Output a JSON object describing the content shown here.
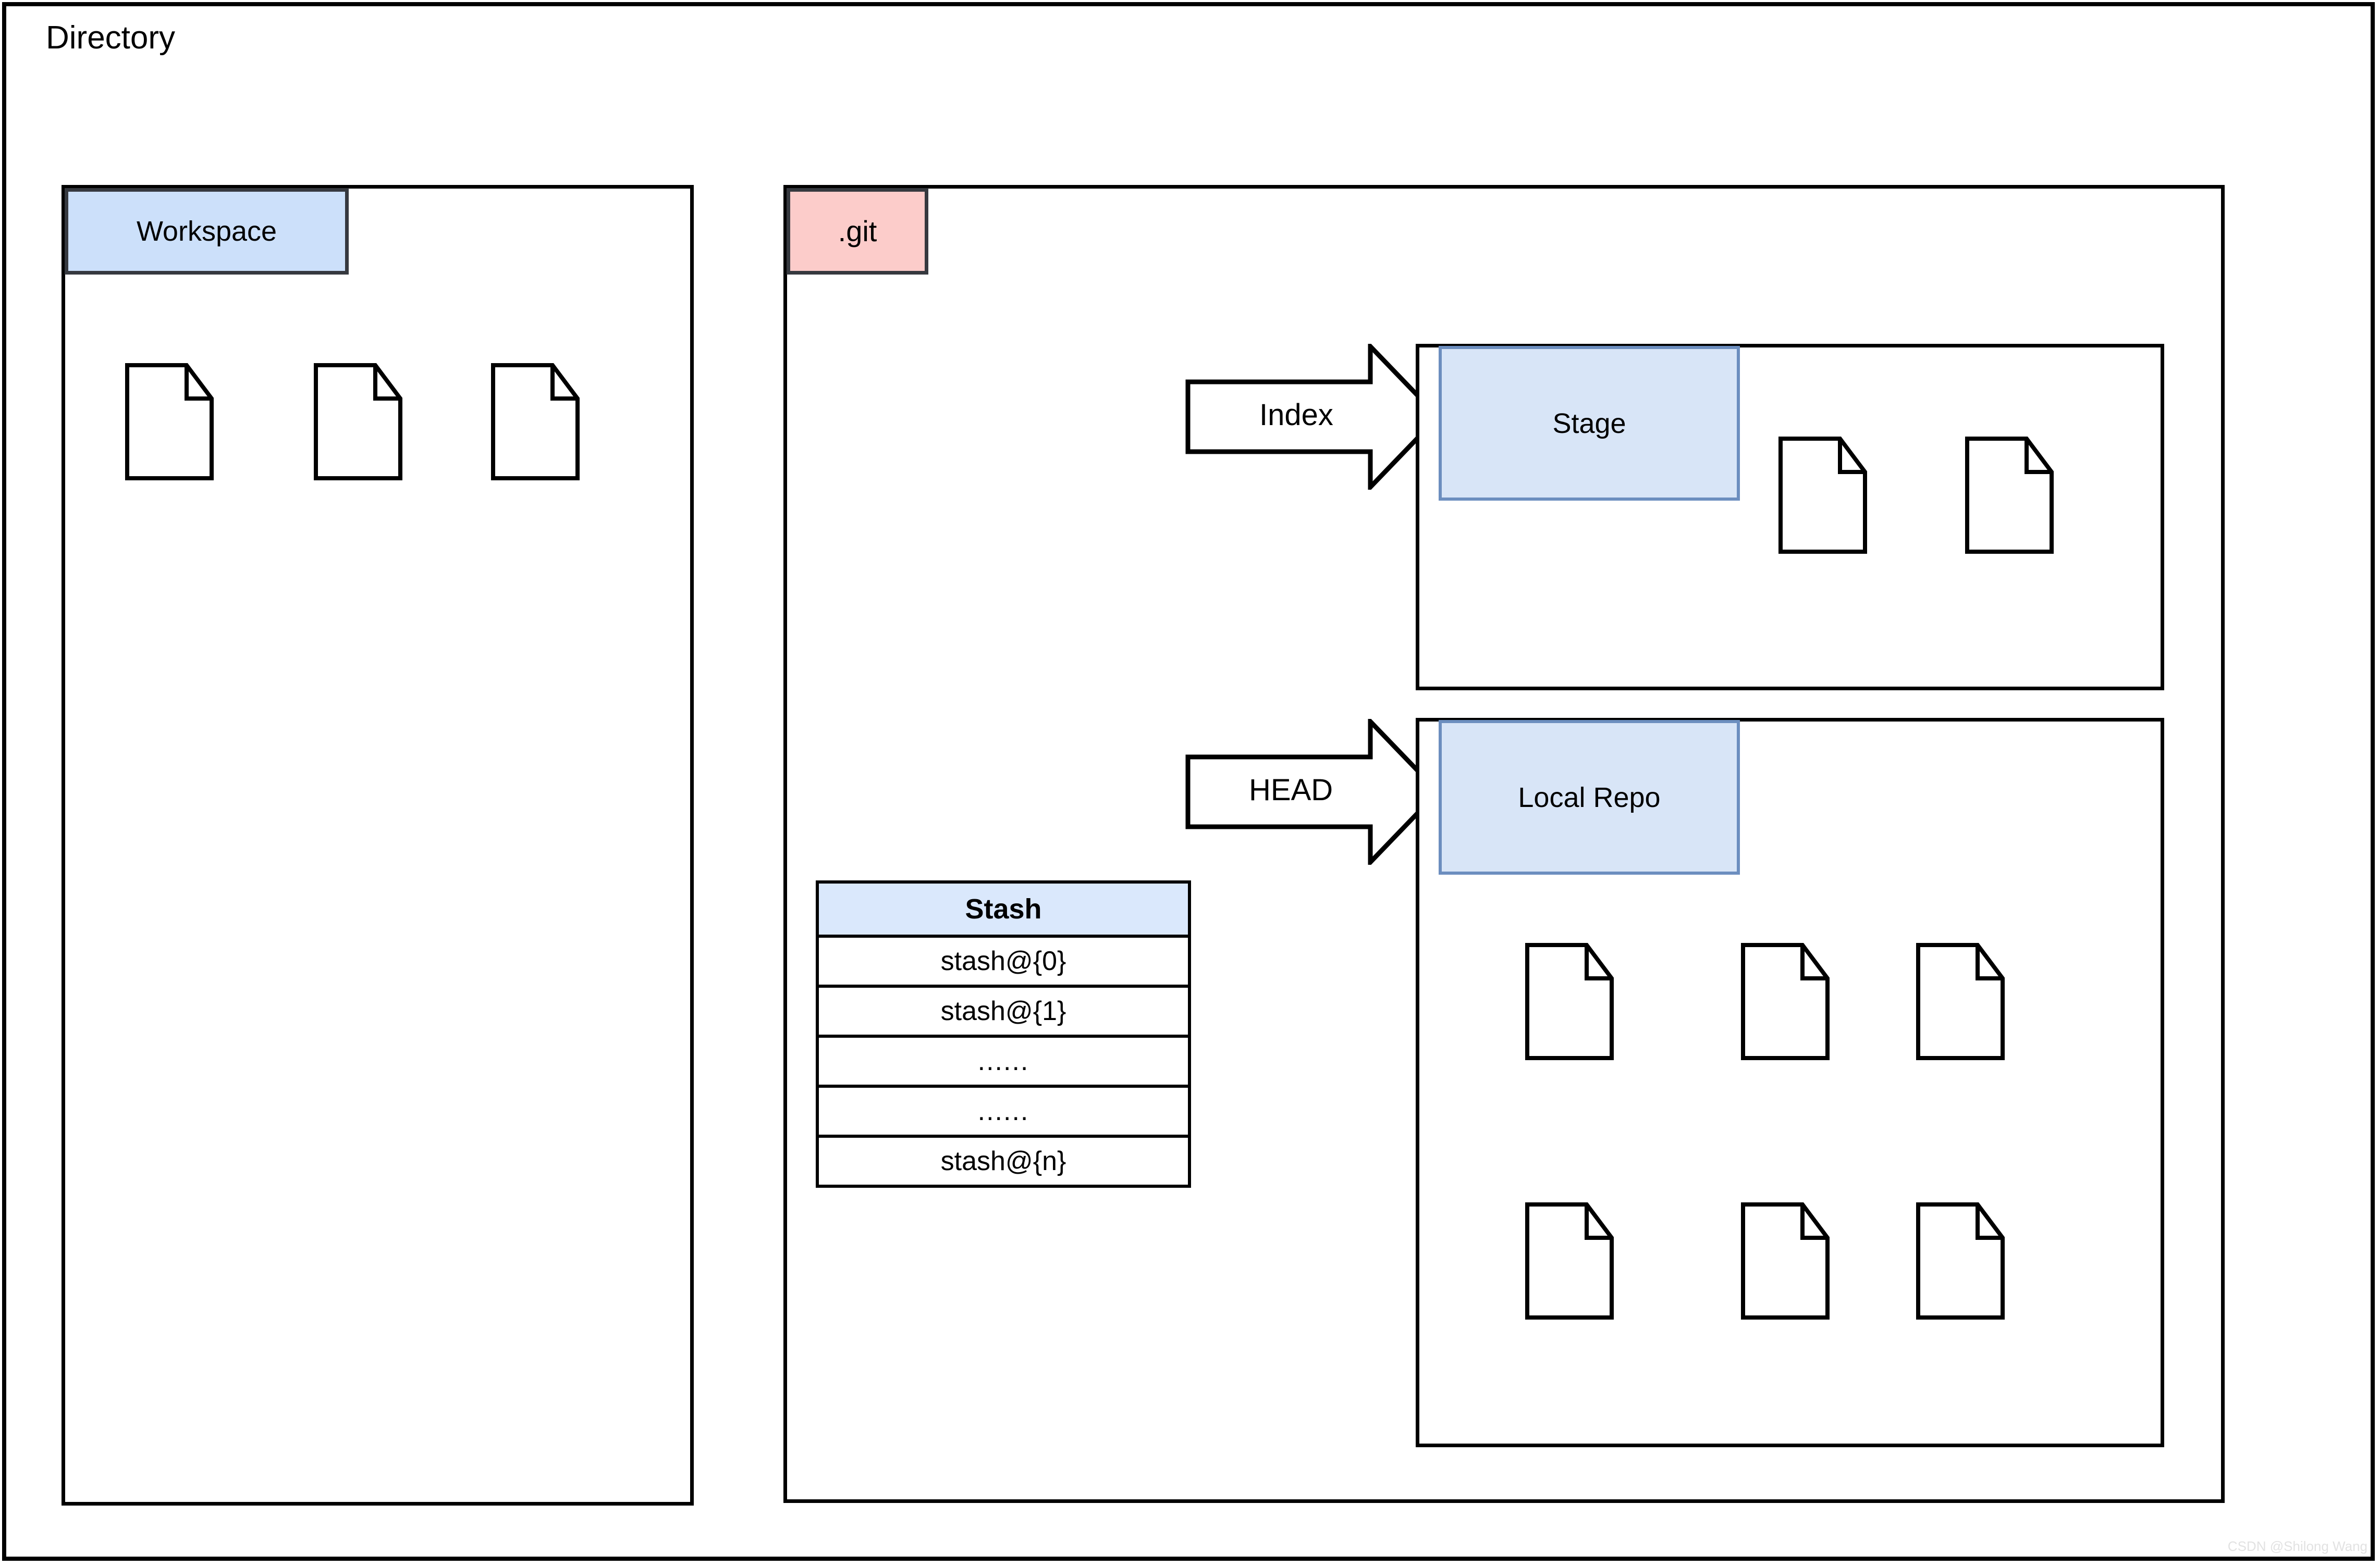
{
  "diagram": {
    "title": "Directory",
    "watermark": "CSDN @Shilong Wang"
  },
  "workspace": {
    "label": "Workspace",
    "files": [
      {
        "name": "workspace-file-1"
      },
      {
        "name": "workspace-file-2"
      },
      {
        "name": "workspace-file-3"
      }
    ]
  },
  "git": {
    "label": ".git",
    "stage": {
      "label": "Stage",
      "arrow_label": "Index",
      "files": [
        {
          "name": "stage-file-1"
        },
        {
          "name": "stage-file-2"
        }
      ]
    },
    "local_repo": {
      "label": "Local Repo",
      "arrow_label": "HEAD",
      "files": [
        {
          "name": "repo-file-1"
        },
        {
          "name": "repo-file-2"
        },
        {
          "name": "repo-file-3"
        },
        {
          "name": "repo-file-4"
        },
        {
          "name": "repo-file-5"
        },
        {
          "name": "repo-file-6"
        }
      ]
    },
    "stash": {
      "header": "Stash",
      "rows": [
        "stash@{0}",
        "stash@{1}",
        "......",
        "......",
        "stash@{n}"
      ]
    }
  },
  "colors": {
    "workspace_tab_fill": "#cce0fa",
    "workspace_tab_border": "#36393f",
    "git_tab_fill": "#fcccca",
    "git_tab_border": "#36393f",
    "stage_tab_fill": "#d8e5f7",
    "stage_tab_border": "#6c8ebf",
    "stash_header_fill": "#dae8fc",
    "outline": "#000000"
  }
}
